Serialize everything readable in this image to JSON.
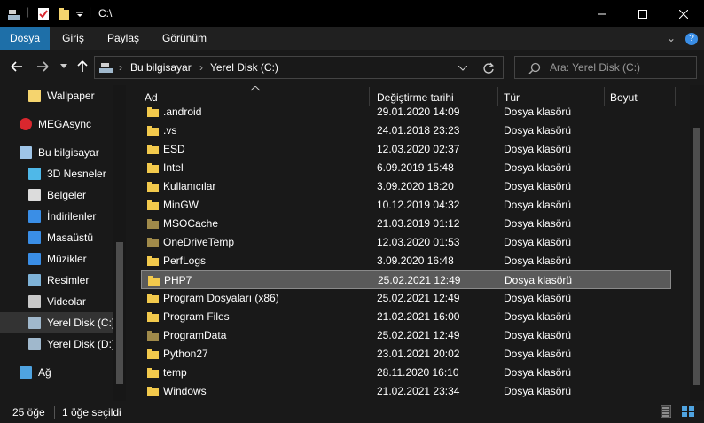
{
  "window": {
    "title": "C:\\",
    "controls": {
      "minimize": "—",
      "maximize": "☐",
      "close": "✕"
    }
  },
  "ribbon": {
    "tabs": [
      "Dosya",
      "Giriş",
      "Paylaş",
      "Görünüm"
    ],
    "expand_glyph": "⌄",
    "help_glyph": "?"
  },
  "address": {
    "crumbs": [
      "Bu bilgisayar",
      "Yerel Disk (C:)"
    ],
    "search_placeholder": "Ara: Yerel Disk (C:)"
  },
  "nav": [
    {
      "label": "Wallpaper",
      "icon": "folder-icon",
      "color": "#f5d46e"
    },
    {
      "label": "MEGAsync",
      "icon": "mega-icon",
      "color": "#d9272e"
    },
    {
      "label": "Bu bilgisayar",
      "icon": "computer-icon",
      "color": "#9fc5e8"
    },
    {
      "label": "3D Nesneler",
      "icon": "cube-icon",
      "color": "#4fb8e8"
    },
    {
      "label": "Belgeler",
      "icon": "document-icon",
      "color": "#dcdcdc"
    },
    {
      "label": "İndirilenler",
      "icon": "download-icon",
      "color": "#3a8ee6"
    },
    {
      "label": "Masaüstü",
      "icon": "desktop-icon",
      "color": "#3a8ee6"
    },
    {
      "label": "Müzikler",
      "icon": "music-icon",
      "color": "#3a8ee6"
    },
    {
      "label": "Resimler",
      "icon": "pictures-icon",
      "color": "#7fb3d8"
    },
    {
      "label": "Videolar",
      "icon": "video-icon",
      "color": "#c9c9c9"
    },
    {
      "label": "Yerel Disk (C:)",
      "icon": "drive-icon",
      "color": "#a0b8cc",
      "selected": true
    },
    {
      "label": "Yerel Disk (D:)",
      "icon": "drive-icon",
      "color": "#a0b8cc"
    },
    {
      "label": "Ağ",
      "icon": "network-icon",
      "color": "#4fa3e0"
    }
  ],
  "columns": {
    "name": "Ad",
    "date": "Değiştirme tarihi",
    "type": "Tür",
    "size": "Boyut"
  },
  "files": [
    {
      "name": ".android",
      "date": "29.01.2020 14:09",
      "type": "Dosya klasörü",
      "color": "#f2c94c"
    },
    {
      "name": ".vs",
      "date": "24.01.2018 23:23",
      "type": "Dosya klasörü",
      "color": "#f2c94c"
    },
    {
      "name": "ESD",
      "date": "12.03.2020 02:37",
      "type": "Dosya klasörü",
      "color": "#f2c94c"
    },
    {
      "name": "Intel",
      "date": "6.09.2019 15:48",
      "type": "Dosya klasörü",
      "color": "#f2c94c"
    },
    {
      "name": "Kullanıcılar",
      "date": "3.09.2020 18:20",
      "type": "Dosya klasörü",
      "color": "#f2c94c"
    },
    {
      "name": "MinGW",
      "date": "10.12.2019 04:32",
      "type": "Dosya klasörü",
      "color": "#f2c94c"
    },
    {
      "name": "MSOCache",
      "date": "21.03.2019 01:12",
      "type": "Dosya klasörü",
      "color": "#a08a4a"
    },
    {
      "name": "OneDriveTemp",
      "date": "12.03.2020 01:53",
      "type": "Dosya klasörü",
      "color": "#a08a4a"
    },
    {
      "name": "PerfLogs",
      "date": "3.09.2020 16:48",
      "type": "Dosya klasörü",
      "color": "#f2c94c"
    },
    {
      "name": "PHP7",
      "date": "25.02.2021 12:49",
      "type": "Dosya klasörü",
      "color": "#f2c94c",
      "selected": true
    },
    {
      "name": "Program Dosyaları (x86)",
      "date": "25.02.2021 12:49",
      "type": "Dosya klasörü",
      "color": "#f2c94c"
    },
    {
      "name": "Program Files",
      "date": "21.02.2021 16:00",
      "type": "Dosya klasörü",
      "color": "#f2c94c"
    },
    {
      "name": "ProgramData",
      "date": "25.02.2021 12:49",
      "type": "Dosya klasörü",
      "color": "#a08a4a"
    },
    {
      "name": "Python27",
      "date": "23.01.2021 20:02",
      "type": "Dosya klasörü",
      "color": "#f2c94c"
    },
    {
      "name": "temp",
      "date": "28.11.2020 16:10",
      "type": "Dosya klasörü",
      "color": "#f2c94c"
    },
    {
      "name": "Windows",
      "date": "21.02.2021 23:34",
      "type": "Dosya klasörü",
      "color": "#f2c94c"
    }
  ],
  "status": {
    "count": "25 öğe",
    "selected": "1 öğe seçildi"
  }
}
